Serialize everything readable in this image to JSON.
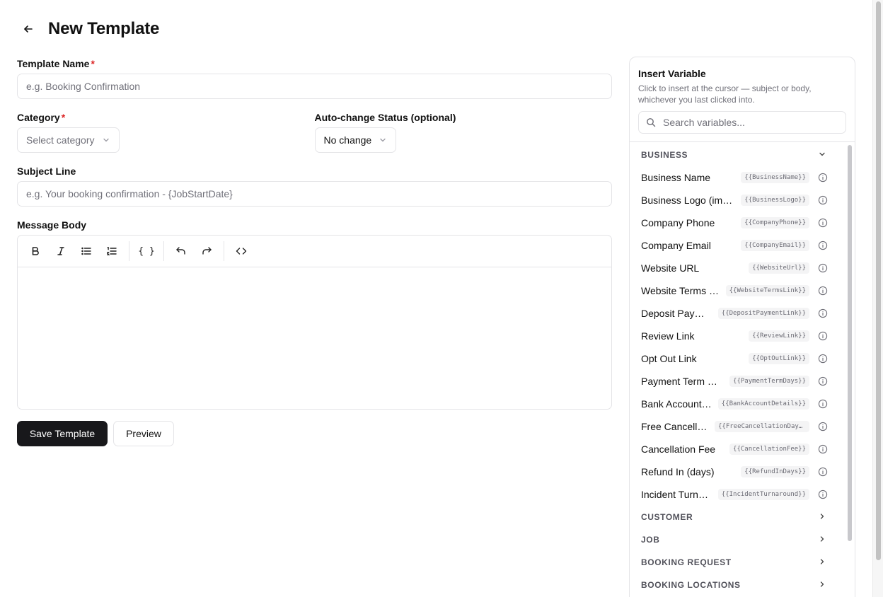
{
  "header": {
    "title": "New Template"
  },
  "form": {
    "template_name": {
      "label": "Template Name",
      "required_mark": "*",
      "placeholder": "e.g. Booking Confirmation"
    },
    "category": {
      "label": "Category",
      "required_mark": "*",
      "placeholder": "Select category"
    },
    "auto_status": {
      "label": "Auto-change Status (optional)",
      "value": "No change"
    },
    "subject": {
      "label": "Subject Line",
      "placeholder": "e.g. Your booking confirmation - {JobStartDate}"
    },
    "body": {
      "label": "Message Body"
    },
    "toolbar": {
      "bold": "bold-icon",
      "italic": "italic-icon",
      "bullet_list": "bullet-list-icon",
      "ordered_list": "ordered-list-icon",
      "variable": "{ }",
      "undo": "undo-icon",
      "redo": "redo-icon",
      "code": "code-icon"
    },
    "save_label": "Save Template",
    "preview_label": "Preview"
  },
  "variables_panel": {
    "title": "Insert Variable",
    "description": "Click to insert at the cursor — subject or body, whichever you last clicked into.",
    "search_placeholder": "Search variables...",
    "groups": [
      {
        "name": "BUSINESS",
        "expanded": true,
        "items": [
          {
            "label": "Business Name",
            "code": "{{BusinessName}}"
          },
          {
            "label": "Business Logo (image)",
            "code": "{{BusinessLogo}}"
          },
          {
            "label": "Company Phone",
            "code": "{{CompanyPhone}}"
          },
          {
            "label": "Company Email",
            "code": "{{CompanyEmail}}"
          },
          {
            "label": "Website URL",
            "code": "{{WebsiteUrl}}"
          },
          {
            "label": "Website Terms Link",
            "code": "{{WebsiteTermsLink}}"
          },
          {
            "label": "Deposit Payment Link",
            "code": "{{DepositPaymentLink}}"
          },
          {
            "label": "Review Link",
            "code": "{{ReviewLink}}"
          },
          {
            "label": "Opt Out Link",
            "code": "{{OptOutLink}}"
          },
          {
            "label": "Payment Term Days",
            "code": "{{PaymentTermDays}}"
          },
          {
            "label": "Bank Account Details",
            "code": "{{BankAccountDetails}}"
          },
          {
            "label": "Free Cancellation Days",
            "code": "{{FreeCancellationDays}}"
          },
          {
            "label": "Cancellation Fee",
            "code": "{{CancellationFee}}"
          },
          {
            "label": "Refund In (days)",
            "code": "{{RefundInDays}}"
          },
          {
            "label": "Incident Turnaround",
            "code": "{{IncidentTurnaround}}"
          }
        ]
      },
      {
        "name": "CUSTOMER",
        "expanded": false
      },
      {
        "name": "JOB",
        "expanded": false
      },
      {
        "name": "BOOKING REQUEST",
        "expanded": false
      },
      {
        "name": "BOOKING LOCATIONS",
        "expanded": false
      }
    ]
  }
}
